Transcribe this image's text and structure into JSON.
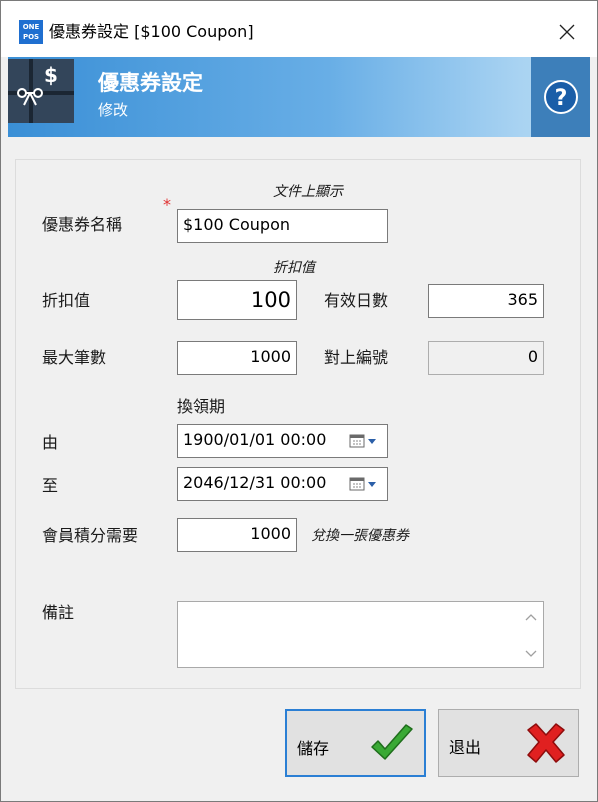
{
  "window": {
    "title": "優惠券設定 [$100 Coupon]",
    "app_icon_text": [
      "ONE",
      "POS"
    ]
  },
  "header": {
    "title": "優惠券設定",
    "subtitle": "修改",
    "icon_text": "$",
    "help_glyph": "?"
  },
  "form": {
    "doc_display_hint": "文件上顯示",
    "coupon_name_label": "優惠券名稱",
    "coupon_name_value": "$100 Coupon",
    "discount_hint": "折扣值",
    "discount_label": "折扣值",
    "discount_value": "100",
    "valid_days_label": "有效日數",
    "valid_days_value": "365",
    "max_count_label": "最大筆數",
    "max_count_value": "1000",
    "ref_number_label": "對上編號",
    "ref_number_value": "0",
    "redeem_period_label": "換領期",
    "from_label": "由",
    "from_value": "1900/01/01 00:00",
    "to_label": "至",
    "to_value": "2046/12/31 00:00",
    "points_label": "會員積分需要",
    "points_value": "1000",
    "points_hint": "兌換一張優惠券",
    "notes_label": "備註",
    "notes_value": ""
  },
  "buttons": {
    "save_label": "儲存",
    "exit_label": "退出"
  },
  "colors": {
    "banner_start": "#3a8fd6",
    "banner_end": "#b6daf4",
    "help_bg": "#3d7fba",
    "required_star": "#e03030",
    "save_focus_border": "#2b7fd4",
    "check_green": "#3aa935",
    "cross_red": "#e02020"
  },
  "icons": {
    "app": "onepos-logo-icon",
    "header": "coupon-ticket-icon",
    "help": "question-icon",
    "close": "close-icon",
    "calendar": "calendar-icon",
    "save": "checkmark-icon",
    "exit": "red-x-icon"
  }
}
